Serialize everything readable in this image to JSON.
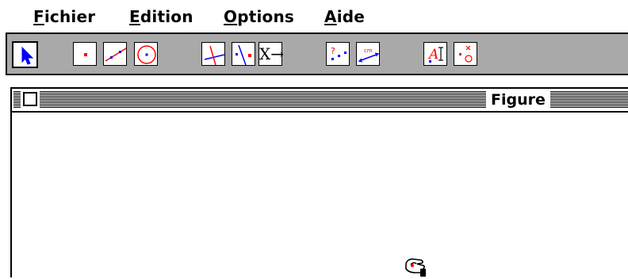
{
  "menubar": {
    "items": [
      {
        "accel": "F",
        "rest": "ichier"
      },
      {
        "accel": "E",
        "rest": "dition"
      },
      {
        "accel": "O",
        "rest": "ptions"
      },
      {
        "accel": "A",
        "rest": "ide"
      }
    ]
  },
  "toolbar": {
    "tools": [
      {
        "icon": "arrow-pointer-icon",
        "selected": true
      },
      {
        "icon": "point-icon"
      },
      {
        "icon": "line-icon"
      },
      {
        "icon": "circle-icon"
      },
      {
        "icon": "perpendicular-icon"
      },
      {
        "icon": "parallel-icon"
      },
      {
        "icon": "transform-icon",
        "label": "X→"
      },
      {
        "icon": "check-property-icon"
      },
      {
        "icon": "measure-icon",
        "label": "cm"
      },
      {
        "icon": "text-label-icon",
        "label": "A"
      },
      {
        "icon": "delete-icon"
      }
    ]
  },
  "window": {
    "title": "Figure"
  },
  "colors": {
    "toolbar_bg": "#a9a9a9",
    "accent_red": "#ff0000",
    "accent_blue": "#0000ff"
  }
}
